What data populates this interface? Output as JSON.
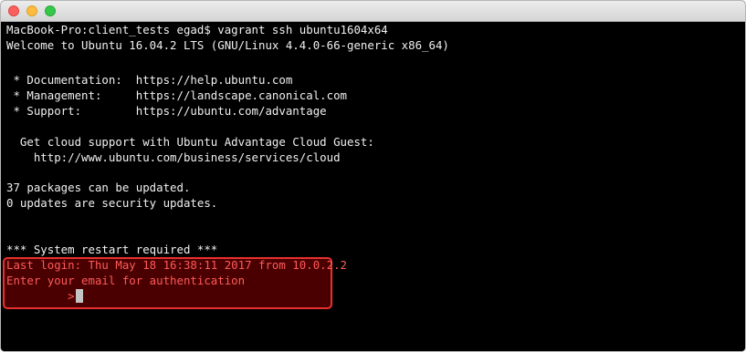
{
  "window": {
    "buttons": [
      "close",
      "minimize",
      "zoom"
    ]
  },
  "terminal": {
    "lines": [
      "MacBook-Pro:client_tests egad$ vagrant ssh ubuntu1604x64",
      "Welcome to Ubuntu 16.04.2 LTS (GNU/Linux 4.4.0-66-generic x86_64)",
      "",
      " * Documentation:  https://help.ubuntu.com",
      " * Management:     https://landscape.canonical.com",
      " * Support:        https://ubuntu.com/advantage",
      "",
      "  Get cloud support with Ubuntu Advantage Cloud Guest:",
      "    http://www.ubuntu.com/business/services/cloud",
      "",
      "37 packages can be updated.",
      "0 updates are security updates.",
      "",
      "",
      "*** System restart required ***",
      "Last login: Thu May 18 16:38:11 2017 from 10.0.2.2",
      "Enter your email for authentication",
      "         >"
    ]
  },
  "colors": {
    "background": "#000000",
    "text": "#f0f0f0",
    "highlight_text": "#ff5a5a",
    "highlight_border": "#e8302f",
    "highlight_fill": "#4a0000",
    "cursor": "#c4c4c4"
  }
}
